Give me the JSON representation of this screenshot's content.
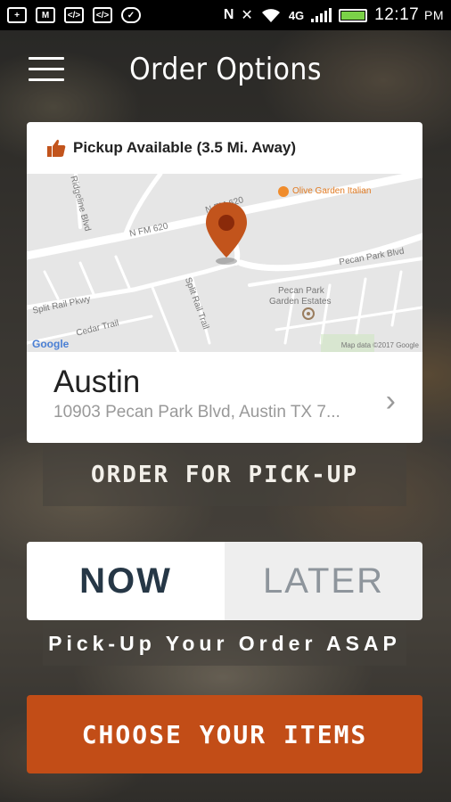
{
  "status_bar": {
    "time": "12:17",
    "ampm": "PM",
    "network": "4G"
  },
  "header": {
    "title": "Order Options"
  },
  "location_card": {
    "pickup_text": "Pickup Available (3.5 Mi. Away)",
    "map_labels": {
      "road_fm620_left": "N FM 620",
      "road_fm620_right": "N FM 620",
      "olive_garden": "Olive Garden Italian",
      "pecan_park_blvd": "Pecan Park Blvd",
      "pecan_park_estates_1": "Pecan Park",
      "pecan_park_estates_2": "Garden Estates",
      "split_rail": "Split Rail Pkwy",
      "cedar_trail": "Cedar Trail",
      "split_rail_trail": "Split Rail Trail",
      "ridgeline": "Ridgeline Blvd",
      "google": "Google",
      "map_data": "Map data ©2017 Google"
    },
    "city": "Austin",
    "address": "10903 Pecan Park Blvd, Austin TX 7..."
  },
  "order_for_pickup_label": "ORDER FOR PICK-UP",
  "timing": {
    "now_label": "NOW",
    "later_label": "LATER",
    "selected": "NOW",
    "subtext": "Pick-Up Your Order ASAP"
  },
  "choose_items_label": "CHOOSE YOUR ITEMS",
  "colors": {
    "accent": "#c24d17",
    "selected_text": "#263746",
    "map_pin": "#c2541c"
  }
}
